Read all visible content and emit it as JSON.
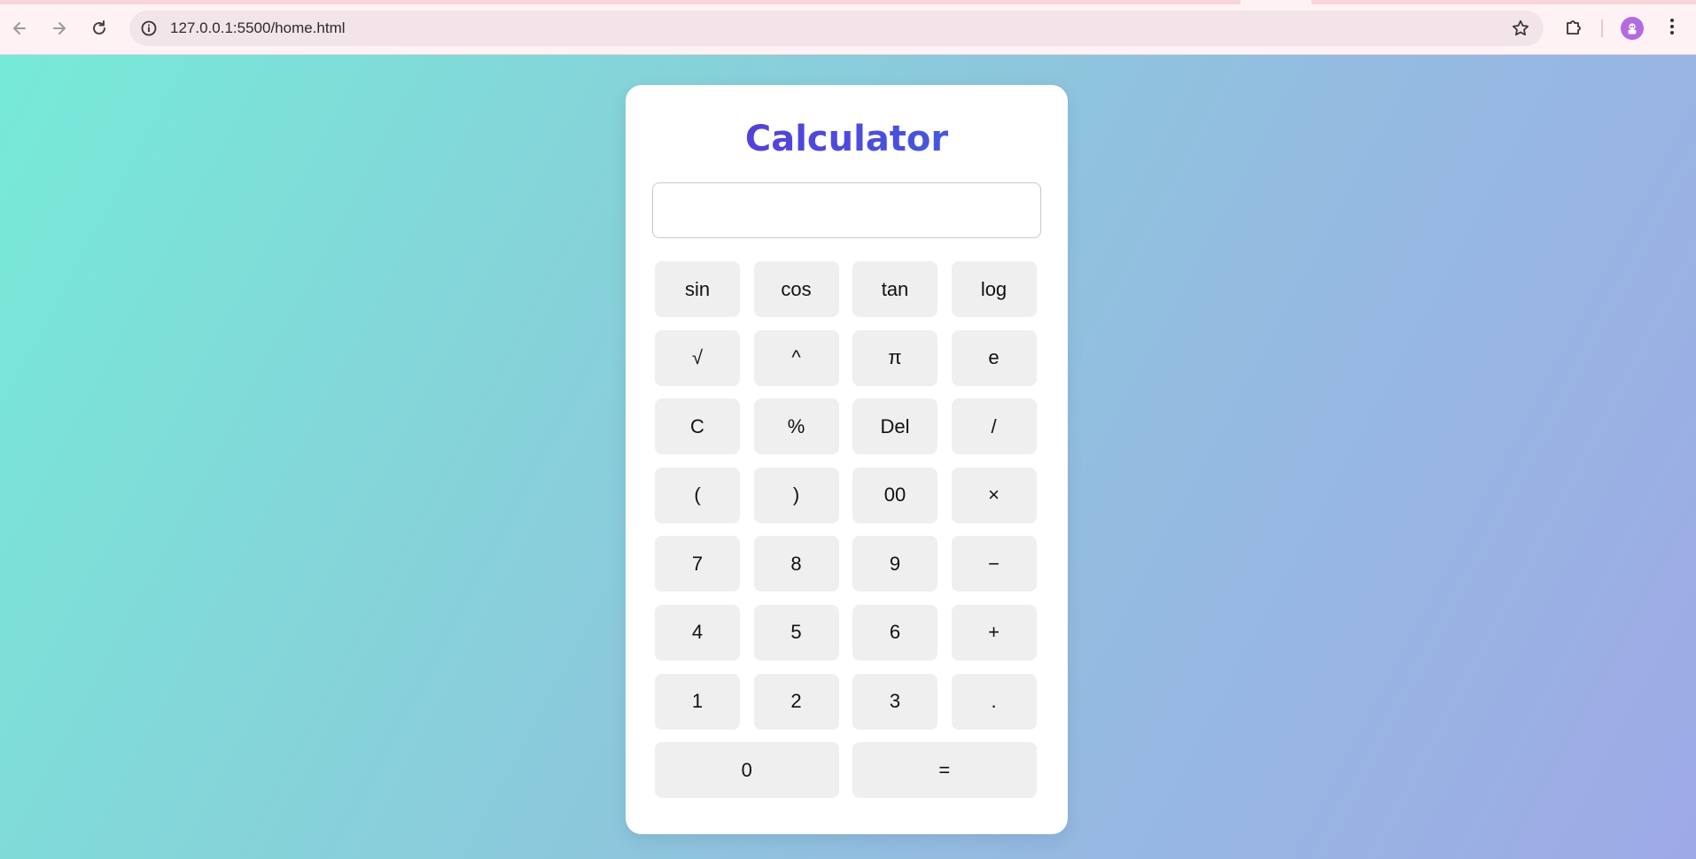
{
  "browser": {
    "url": "127.0.0.1:5500/home.html",
    "icons": {
      "back": "back-arrow-icon",
      "forward": "forward-arrow-icon",
      "reload": "reload-icon",
      "site_info": "info-icon",
      "bookmark": "star-icon",
      "extensions": "puzzle-icon",
      "profile": "avatar",
      "menu": "kebab-menu-icon"
    },
    "colors": {
      "toolbar": "#fff2f4",
      "omnibox": "#f3e4e9"
    }
  },
  "calculator": {
    "title": "Calculator",
    "display_value": "",
    "keys": [
      {
        "label": "sin",
        "name": "key-sin"
      },
      {
        "label": "cos",
        "name": "key-cos"
      },
      {
        "label": "tan",
        "name": "key-tan"
      },
      {
        "label": "log",
        "name": "key-log"
      },
      {
        "label": "√",
        "name": "key-sqrt"
      },
      {
        "label": "^",
        "name": "key-power"
      },
      {
        "label": "π",
        "name": "key-pi"
      },
      {
        "label": "e",
        "name": "key-e"
      },
      {
        "label": "C",
        "name": "key-clear"
      },
      {
        "label": "%",
        "name": "key-percent"
      },
      {
        "label": "Del",
        "name": "key-delete"
      },
      {
        "label": "/",
        "name": "key-divide"
      },
      {
        "label": "(",
        "name": "key-open-paren"
      },
      {
        "label": ")",
        "name": "key-close-paren"
      },
      {
        "label": "00",
        "name": "key-double-zero"
      },
      {
        "label": "×",
        "name": "key-multiply"
      },
      {
        "label": "7",
        "name": "key-7"
      },
      {
        "label": "8",
        "name": "key-8"
      },
      {
        "label": "9",
        "name": "key-9"
      },
      {
        "label": "−",
        "name": "key-subtract"
      },
      {
        "label": "4",
        "name": "key-4"
      },
      {
        "label": "5",
        "name": "key-5"
      },
      {
        "label": "6",
        "name": "key-6"
      },
      {
        "label": "+",
        "name": "key-add"
      },
      {
        "label": "1",
        "name": "key-1"
      },
      {
        "label": "2",
        "name": "key-2"
      },
      {
        "label": "3",
        "name": "key-3"
      },
      {
        "label": ".",
        "name": "key-decimal"
      },
      {
        "label": "0",
        "name": "key-0"
      },
      {
        "label": "=",
        "name": "key-equals"
      }
    ],
    "colors": {
      "title_gradient_start": "#5b34d8",
      "title_gradient_end": "#3d63e0",
      "key_background": "#efefef",
      "card_background": "#ffffff",
      "page_gradient_start": "#76ead8",
      "page_gradient_end": "#9eaae6"
    }
  }
}
